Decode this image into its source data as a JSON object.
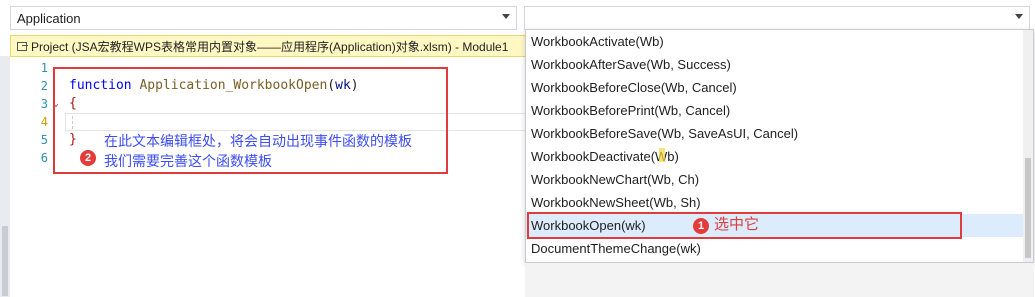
{
  "combos": {
    "object_selector": "Application",
    "procedure_selector": ""
  },
  "tab": {
    "title": "Project (JSA宏教程WPS表格常用内置对象——应用程序(Application)对象.xlsm) - Module1"
  },
  "editor": {
    "line_numbers": [
      "1",
      "2",
      "3",
      "4",
      "5",
      "6"
    ],
    "line2": {
      "keyword": "function",
      "name": "Application_WorkbookOpen",
      "open_paren": "(",
      "param": "wk",
      "close_paren": ")"
    },
    "line3": "{",
    "line5": "}"
  },
  "annotations": {
    "badge_2": "2",
    "note_line1": "在此文本编辑框处，将会自动出现事件函数的模板",
    "note_line2": "我们需要完善这个函数模板",
    "badge_1": "1",
    "select_note": "选中它"
  },
  "dropdown": {
    "items": [
      "WorkbookActivate(Wb)",
      "WorkbookAfterSave(Wb, Success)",
      "WorkbookBeforeClose(Wb, Cancel)",
      "WorkbookBeforePrint(Wb, Cancel)",
      "WorkbookBeforeSave(Wb, SaveAsUI, Cancel)",
      "WorkbookDeactivate(Wb)",
      "WorkbookNewChart(Wb, Ch)",
      "WorkbookNewSheet(Wb, Sh)",
      "WorkbookOpen(wk)",
      "DocumentThemeChange(wk)"
    ],
    "selected": "WorkbookOpen(wk)"
  },
  "colors": {
    "annotation_red": "#e03c3c",
    "note_blue": "#3d4df2",
    "selection_bg": "#dcecfc",
    "tab_bg": "#fff8c2"
  }
}
